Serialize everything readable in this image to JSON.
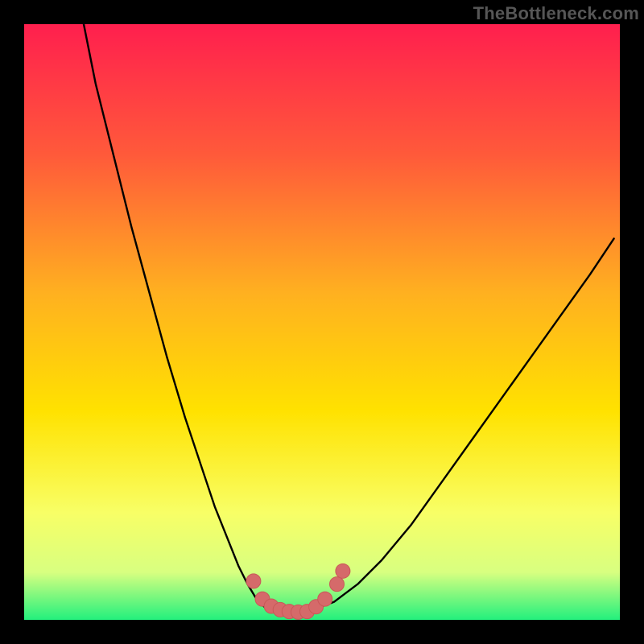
{
  "watermark": "TheBottleneck.com",
  "colors": {
    "frame": "#000000",
    "gradient_top": "#ff1f4e",
    "gradient_mid1": "#ff7a2a",
    "gradient_mid2": "#ffe200",
    "gradient_low1": "#f6ff7a",
    "gradient_low2": "#c8ff8a",
    "gradient_bottom": "#23f07d",
    "curve": "#000000",
    "dots_fill": "#d56a6a",
    "dots_stroke": "#c95858"
  },
  "chart_data": {
    "type": "line",
    "title": "",
    "xlabel": "",
    "ylabel": "",
    "xlim": [
      0,
      100
    ],
    "ylim": [
      0,
      100
    ],
    "curve": {
      "x": [
        10,
        12,
        15,
        18,
        21,
        24,
        27,
        30,
        32,
        34,
        36,
        37.5,
        39,
        40.5,
        42,
        44,
        46,
        48,
        52,
        56,
        60,
        65,
        70,
        75,
        80,
        85,
        90,
        95,
        99
      ],
      "y": [
        100,
        90,
        78,
        66,
        55,
        44,
        34,
        25,
        19,
        14,
        9,
        6,
        3.5,
        2,
        1.2,
        1.0,
        1.0,
        1.5,
        3,
        6,
        10,
        16,
        23,
        30,
        37,
        44,
        51,
        58,
        64
      ]
    },
    "dots": [
      {
        "x": 38.5,
        "y": 6.5
      },
      {
        "x": 40.0,
        "y": 3.5
      },
      {
        "x": 41.5,
        "y": 2.3
      },
      {
        "x": 43.0,
        "y": 1.7
      },
      {
        "x": 44.5,
        "y": 1.4
      },
      {
        "x": 46.0,
        "y": 1.3
      },
      {
        "x": 47.5,
        "y": 1.4
      },
      {
        "x": 49.0,
        "y": 2.2
      },
      {
        "x": 50.5,
        "y": 3.5
      },
      {
        "x": 52.5,
        "y": 6.0
      },
      {
        "x": 53.5,
        "y": 8.2
      }
    ]
  }
}
